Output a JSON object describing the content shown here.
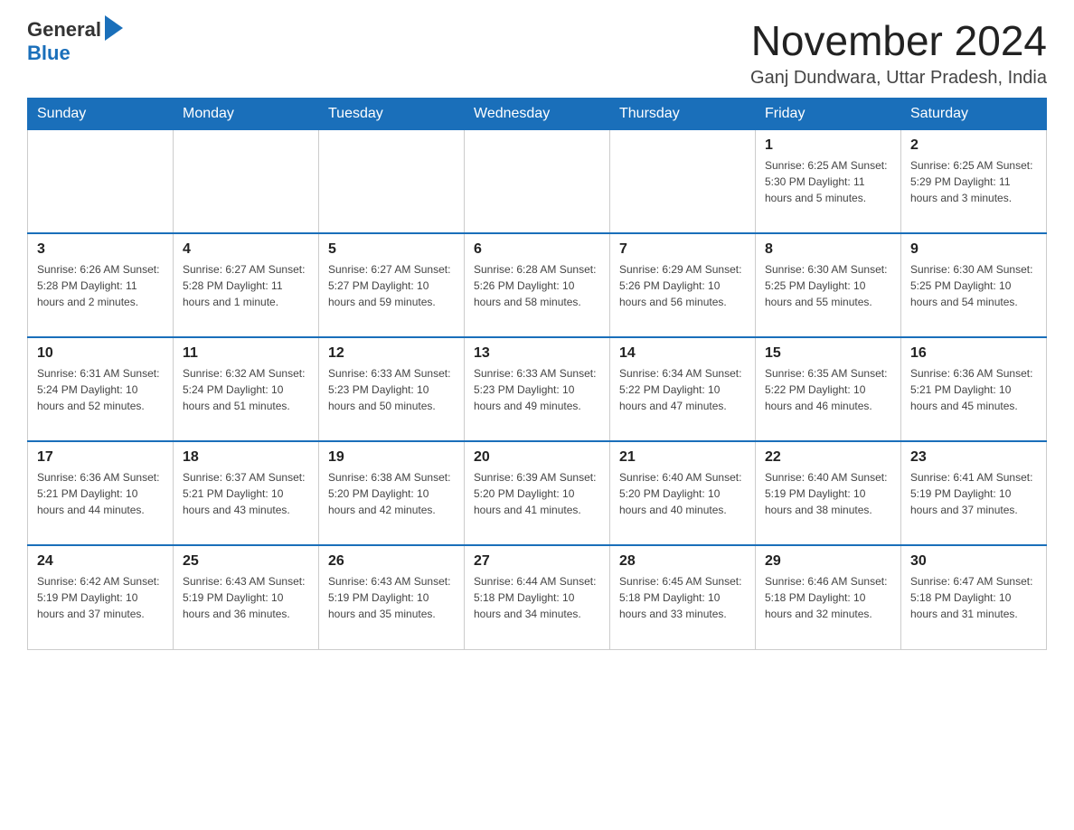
{
  "header": {
    "logo": {
      "general": "General",
      "blue": "Blue"
    },
    "title": "November 2024",
    "subtitle": "Ganj Dundwara, Uttar Pradesh, India"
  },
  "weekdays": [
    "Sunday",
    "Monday",
    "Tuesday",
    "Wednesday",
    "Thursday",
    "Friday",
    "Saturday"
  ],
  "weeks": [
    [
      {
        "day": "",
        "info": ""
      },
      {
        "day": "",
        "info": ""
      },
      {
        "day": "",
        "info": ""
      },
      {
        "day": "",
        "info": ""
      },
      {
        "day": "",
        "info": ""
      },
      {
        "day": "1",
        "info": "Sunrise: 6:25 AM\nSunset: 5:30 PM\nDaylight: 11 hours and 5 minutes."
      },
      {
        "day": "2",
        "info": "Sunrise: 6:25 AM\nSunset: 5:29 PM\nDaylight: 11 hours and 3 minutes."
      }
    ],
    [
      {
        "day": "3",
        "info": "Sunrise: 6:26 AM\nSunset: 5:28 PM\nDaylight: 11 hours and 2 minutes."
      },
      {
        "day": "4",
        "info": "Sunrise: 6:27 AM\nSunset: 5:28 PM\nDaylight: 11 hours and 1 minute."
      },
      {
        "day": "5",
        "info": "Sunrise: 6:27 AM\nSunset: 5:27 PM\nDaylight: 10 hours and 59 minutes."
      },
      {
        "day": "6",
        "info": "Sunrise: 6:28 AM\nSunset: 5:26 PM\nDaylight: 10 hours and 58 minutes."
      },
      {
        "day": "7",
        "info": "Sunrise: 6:29 AM\nSunset: 5:26 PM\nDaylight: 10 hours and 56 minutes."
      },
      {
        "day": "8",
        "info": "Sunrise: 6:30 AM\nSunset: 5:25 PM\nDaylight: 10 hours and 55 minutes."
      },
      {
        "day": "9",
        "info": "Sunrise: 6:30 AM\nSunset: 5:25 PM\nDaylight: 10 hours and 54 minutes."
      }
    ],
    [
      {
        "day": "10",
        "info": "Sunrise: 6:31 AM\nSunset: 5:24 PM\nDaylight: 10 hours and 52 minutes."
      },
      {
        "day": "11",
        "info": "Sunrise: 6:32 AM\nSunset: 5:24 PM\nDaylight: 10 hours and 51 minutes."
      },
      {
        "day": "12",
        "info": "Sunrise: 6:33 AM\nSunset: 5:23 PM\nDaylight: 10 hours and 50 minutes."
      },
      {
        "day": "13",
        "info": "Sunrise: 6:33 AM\nSunset: 5:23 PM\nDaylight: 10 hours and 49 minutes."
      },
      {
        "day": "14",
        "info": "Sunrise: 6:34 AM\nSunset: 5:22 PM\nDaylight: 10 hours and 47 minutes."
      },
      {
        "day": "15",
        "info": "Sunrise: 6:35 AM\nSunset: 5:22 PM\nDaylight: 10 hours and 46 minutes."
      },
      {
        "day": "16",
        "info": "Sunrise: 6:36 AM\nSunset: 5:21 PM\nDaylight: 10 hours and 45 minutes."
      }
    ],
    [
      {
        "day": "17",
        "info": "Sunrise: 6:36 AM\nSunset: 5:21 PM\nDaylight: 10 hours and 44 minutes."
      },
      {
        "day": "18",
        "info": "Sunrise: 6:37 AM\nSunset: 5:21 PM\nDaylight: 10 hours and 43 minutes."
      },
      {
        "day": "19",
        "info": "Sunrise: 6:38 AM\nSunset: 5:20 PM\nDaylight: 10 hours and 42 minutes."
      },
      {
        "day": "20",
        "info": "Sunrise: 6:39 AM\nSunset: 5:20 PM\nDaylight: 10 hours and 41 minutes."
      },
      {
        "day": "21",
        "info": "Sunrise: 6:40 AM\nSunset: 5:20 PM\nDaylight: 10 hours and 40 minutes."
      },
      {
        "day": "22",
        "info": "Sunrise: 6:40 AM\nSunset: 5:19 PM\nDaylight: 10 hours and 38 minutes."
      },
      {
        "day": "23",
        "info": "Sunrise: 6:41 AM\nSunset: 5:19 PM\nDaylight: 10 hours and 37 minutes."
      }
    ],
    [
      {
        "day": "24",
        "info": "Sunrise: 6:42 AM\nSunset: 5:19 PM\nDaylight: 10 hours and 37 minutes."
      },
      {
        "day": "25",
        "info": "Sunrise: 6:43 AM\nSunset: 5:19 PM\nDaylight: 10 hours and 36 minutes."
      },
      {
        "day": "26",
        "info": "Sunrise: 6:43 AM\nSunset: 5:19 PM\nDaylight: 10 hours and 35 minutes."
      },
      {
        "day": "27",
        "info": "Sunrise: 6:44 AM\nSunset: 5:18 PM\nDaylight: 10 hours and 34 minutes."
      },
      {
        "day": "28",
        "info": "Sunrise: 6:45 AM\nSunset: 5:18 PM\nDaylight: 10 hours and 33 minutes."
      },
      {
        "day": "29",
        "info": "Sunrise: 6:46 AM\nSunset: 5:18 PM\nDaylight: 10 hours and 32 minutes."
      },
      {
        "day": "30",
        "info": "Sunrise: 6:47 AM\nSunset: 5:18 PM\nDaylight: 10 hours and 31 minutes."
      }
    ]
  ]
}
